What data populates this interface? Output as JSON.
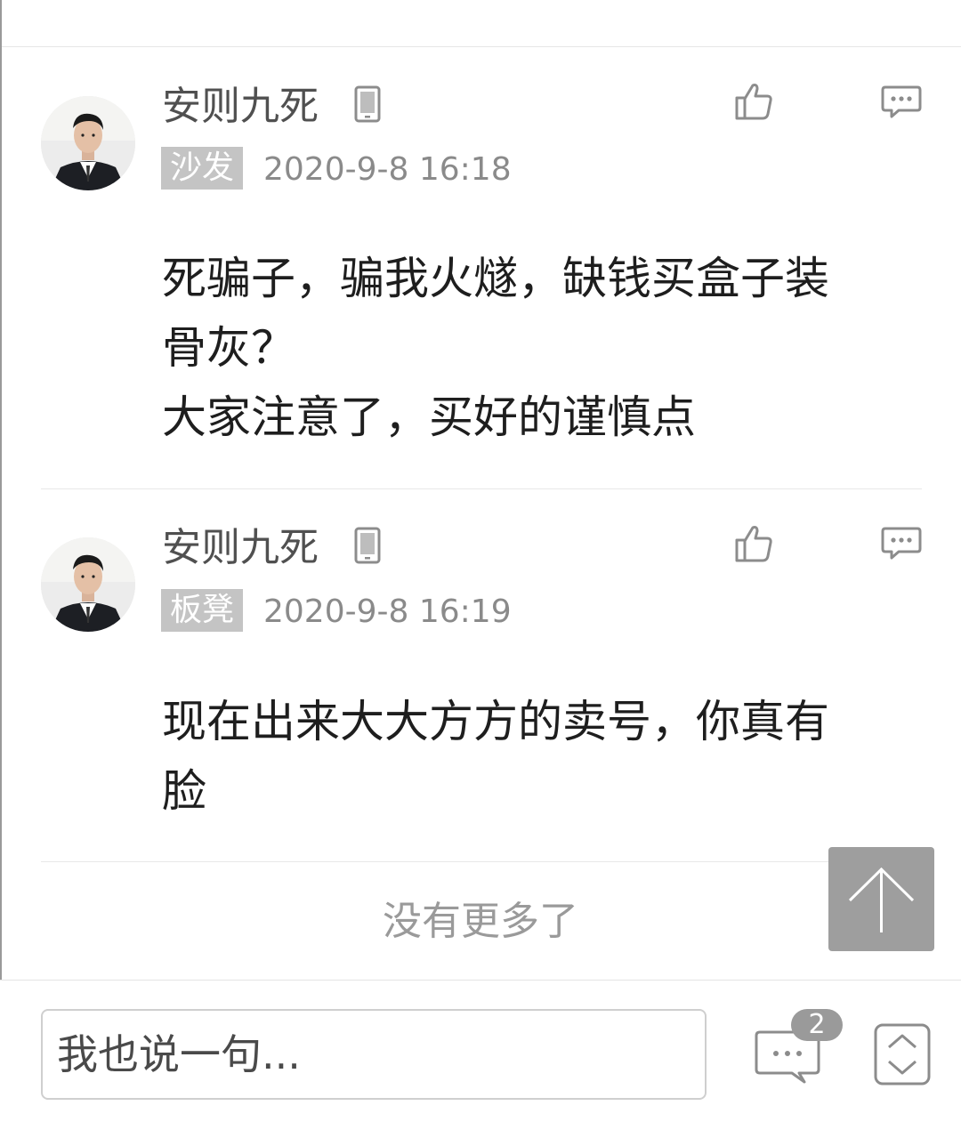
{
  "comments": [
    {
      "username": "安则九死",
      "floor": "沙发",
      "time": "2020-9-8 16:18",
      "text": "死骗子，骗我火燧，缺钱买盒子装\n骨灰？\n大家注意了，买好的谨慎点"
    },
    {
      "username": "安则九死",
      "floor": "板凳",
      "time": "2020-9-8 16:19",
      "text": "现在出来大大方方的卖号，你真有\n脸"
    }
  ],
  "footer": {
    "no_more": "没有更多了"
  },
  "bottom_bar": {
    "input_placeholder": "我也说一句...",
    "comment_count": "2"
  },
  "icons": {
    "device": "phone-icon",
    "like": "thumbs-up-icon",
    "reply": "comment-bubble-icon",
    "back_to_top": "arrow-up-icon",
    "comments": "comment-bubble-icon",
    "scroll": "chevron-up-down-icon"
  },
  "colors": {
    "badge_bg": "#c4c4c4",
    "muted_text": "#8a8a8a",
    "icon_gray": "#8c8c8c",
    "back_to_top_bg": "#9e9e9e"
  }
}
